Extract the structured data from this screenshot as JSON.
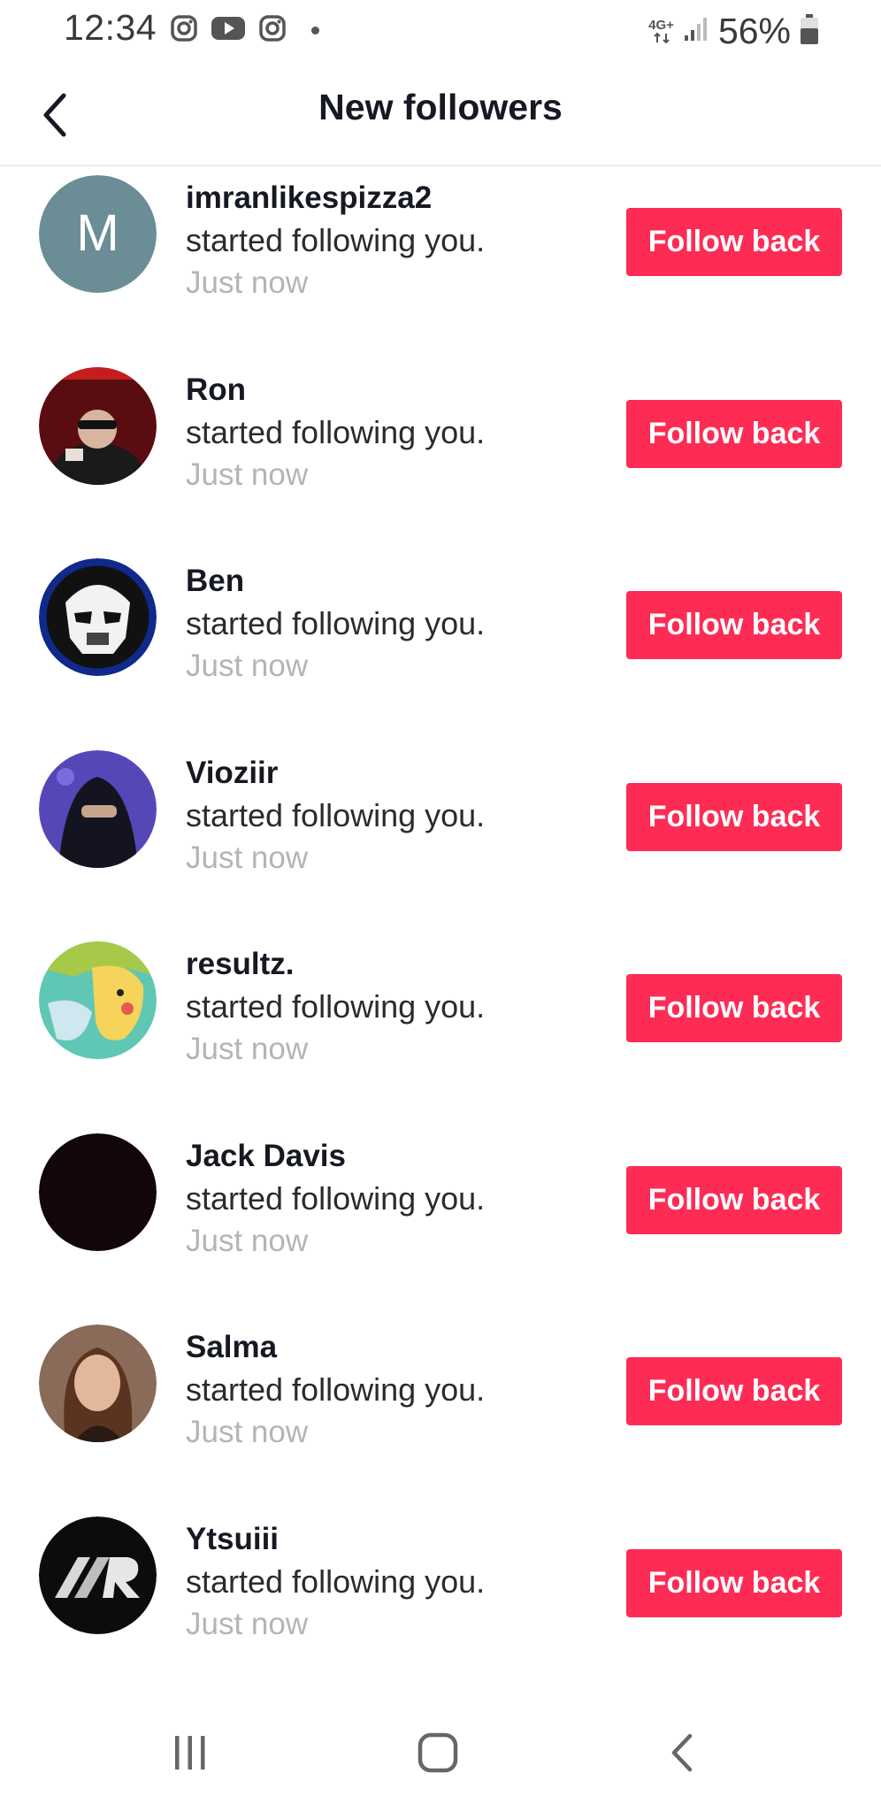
{
  "status_bar": {
    "time": "12:34",
    "network_type": "4G+",
    "battery_percent": "56%",
    "notification_icons": [
      "instagram-icon",
      "youtube-icon",
      "instagram-icon"
    ]
  },
  "header": {
    "title": "New followers",
    "back_icon": "chevron-left-icon"
  },
  "followers": [
    {
      "username": "imranlikespizza2",
      "action": "started following you.",
      "time": "Just now",
      "button": "Follow back",
      "avatar_initial": "M",
      "avatar_color": "#6b8e96"
    },
    {
      "username": "Ron",
      "action": "started following you.",
      "time": "Just now",
      "button": "Follow back",
      "avatar_color": "#5a0d10"
    },
    {
      "username": "Ben",
      "action": "started following you.",
      "time": "Just now",
      "button": "Follow back",
      "avatar_color": "#0f2a8a"
    },
    {
      "username": "Vioziir",
      "action": "started following you.",
      "time": "Just now",
      "button": "Follow back",
      "avatar_color": "#5547b8"
    },
    {
      "username": "resultz.",
      "action": "started following you.",
      "time": "Just now",
      "button": "Follow back",
      "avatar_color": "#5fc7b4"
    },
    {
      "username": "Jack Davis",
      "action": "started following you.",
      "time": "Just now",
      "button": "Follow back",
      "avatar_color": "#12060a"
    },
    {
      "username": "Salma",
      "action": "started following you.",
      "time": "Just now",
      "button": "Follow back",
      "avatar_color": "#8a6a58"
    },
    {
      "username": "Ytsuiii",
      "action": "started following you.",
      "time": "Just now",
      "button": "Follow back",
      "avatar_color": "#0c0c0c"
    }
  ],
  "colors": {
    "accent": "#fe2c55",
    "muted_text": "#b4b4b8"
  },
  "system_nav": [
    "recent-apps-icon",
    "home-icon",
    "back-icon"
  ]
}
